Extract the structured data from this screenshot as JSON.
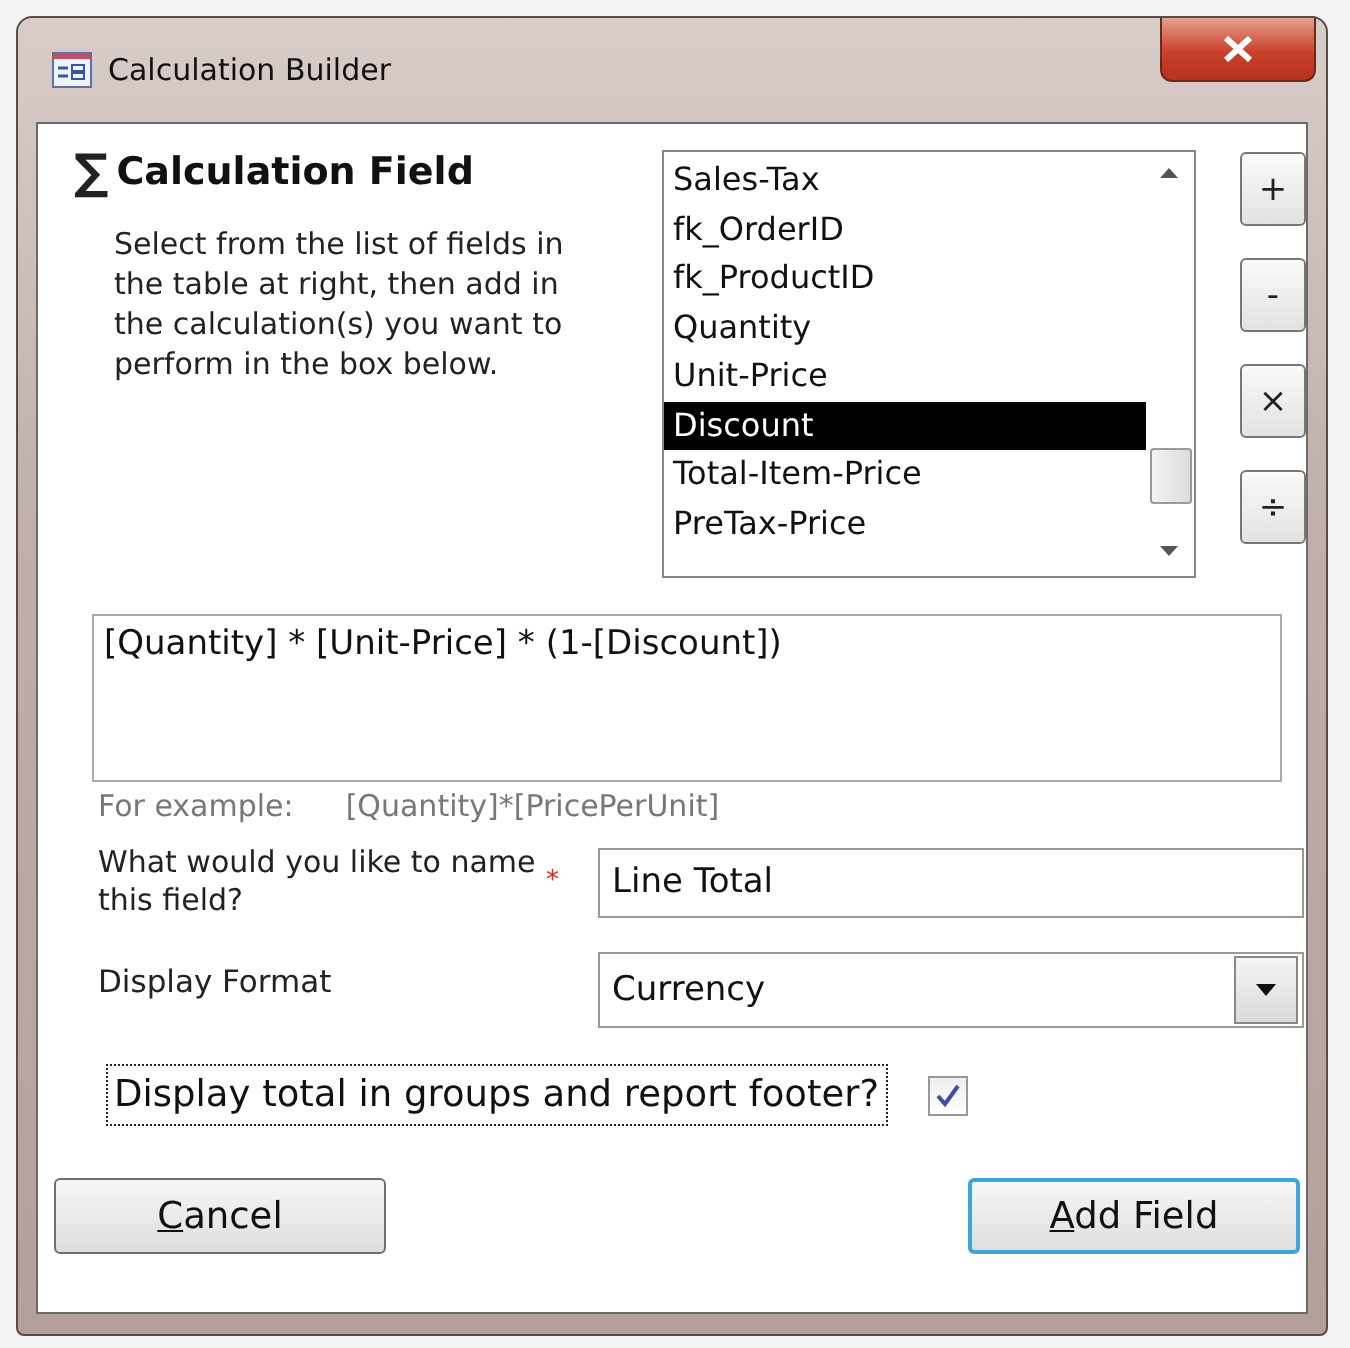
{
  "window": {
    "title": "Calculation Builder"
  },
  "header": {
    "symbol": "∑",
    "title": "Calculation Field",
    "instructions": "Select from the list of fields in the table at right, then add in the calculation(s) you want to perform in the box below."
  },
  "field_list": [
    {
      "label": "Sales-Tax",
      "selected": false
    },
    {
      "label": "fk_OrderID",
      "selected": false
    },
    {
      "label": "fk_ProductID",
      "selected": false
    },
    {
      "label": "Quantity",
      "selected": false
    },
    {
      "label": "Unit-Price",
      "selected": false
    },
    {
      "label": "Discount",
      "selected": true
    },
    {
      "label": "Total-Item-Price",
      "selected": false
    },
    {
      "label": "PreTax-Price",
      "selected": false
    }
  ],
  "operators": [
    "+",
    "-",
    "×",
    "÷"
  ],
  "formula": "[Quantity] * [Unit-Price] * (1-[Discount])",
  "example": {
    "label": "For example:",
    "value": "[Quantity]*[PricePerUnit]"
  },
  "name_field": {
    "label": "What would you like to name this field?",
    "required_mark": "*",
    "value": "Line Total"
  },
  "display_format": {
    "label": "Display Format",
    "value": "Currency"
  },
  "display_total": {
    "label": "Display total in groups and report footer?",
    "checked": true,
    "focused": true
  },
  "buttons": [
    {
      "label": "Cancel",
      "default": false,
      "access_key_underlined": true
    },
    {
      "label": "Add Field",
      "default": true,
      "access_key_underlined": true
    }
  ]
}
